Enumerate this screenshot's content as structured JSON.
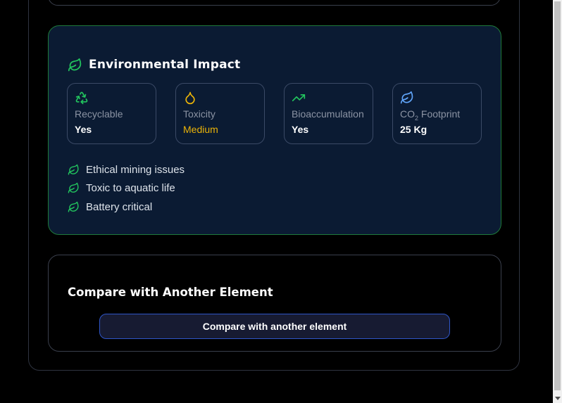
{
  "environment": {
    "title": "Environmental Impact",
    "metrics": [
      {
        "icon": "recycle-icon",
        "label": "Recyclable",
        "value": "Yes"
      },
      {
        "icon": "droplet-icon",
        "label": "Toxicity",
        "value": "Medium"
      },
      {
        "icon": "trending-up-icon",
        "label": "Bioaccumulation",
        "value": "Yes"
      },
      {
        "icon": "leaf-icon",
        "label_prefix": "CO",
        "label_sub": "2",
        "label_suffix": " Footprint",
        "value": "25 Kg"
      }
    ],
    "impacts": [
      "Ethical mining issues",
      "Toxic to aquatic life",
      "Battery critical"
    ]
  },
  "compare": {
    "title": "Compare with Another Element",
    "button_label": "Compare with another element"
  },
  "colors": {
    "accent_green": "#22c55e",
    "warning_yellow": "#eab308",
    "card_background": "#0b1b33",
    "button_border": "#2f56c8"
  }
}
